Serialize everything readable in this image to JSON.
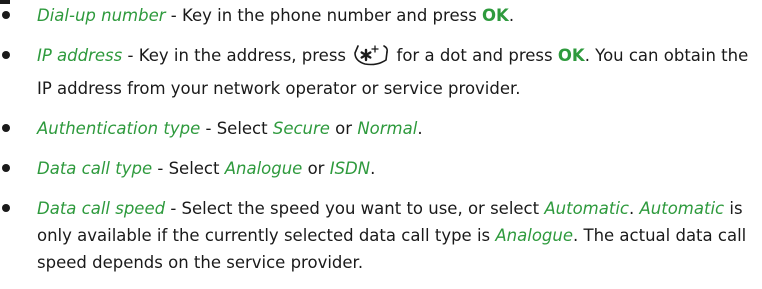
{
  "items": [
    {
      "term": "Dial-up number",
      "sep": " - ",
      "t1": "Key in the phone number and press ",
      "ok": "OK",
      "t2": "."
    },
    {
      "term": "IP address",
      "sep": " - ",
      "t1": "Key in the address, press ",
      "key_icon": "star-key-icon",
      "t2": " for a dot and press ",
      "ok": "OK",
      "t3": ". You can obtain the IP address from your network operator or service provider."
    },
    {
      "term": "Authentication type",
      "sep": " - ",
      "t1": "Select ",
      "o1": "Secure",
      "t2": " or ",
      "o2": "Normal",
      "t3": "."
    },
    {
      "term": "Data call type",
      "sep": " - ",
      "t1": "Select ",
      "o1": "Analogue",
      "t2": " or ",
      "o2": "ISDN",
      "t3": "."
    },
    {
      "term": "Data call speed",
      "sep": " - ",
      "t1": "Select the speed you want to use, or select ",
      "o1": "Automatic",
      "t2": ". ",
      "o2": "Automatic",
      "t3": " is only available if the currently selected data call type is ",
      "o3": "Analogue",
      "t4": ". The actual data call speed depends on the service provider."
    }
  ],
  "colors": {
    "accent": "#2e9a3d",
    "text": "#1a1a1a"
  }
}
